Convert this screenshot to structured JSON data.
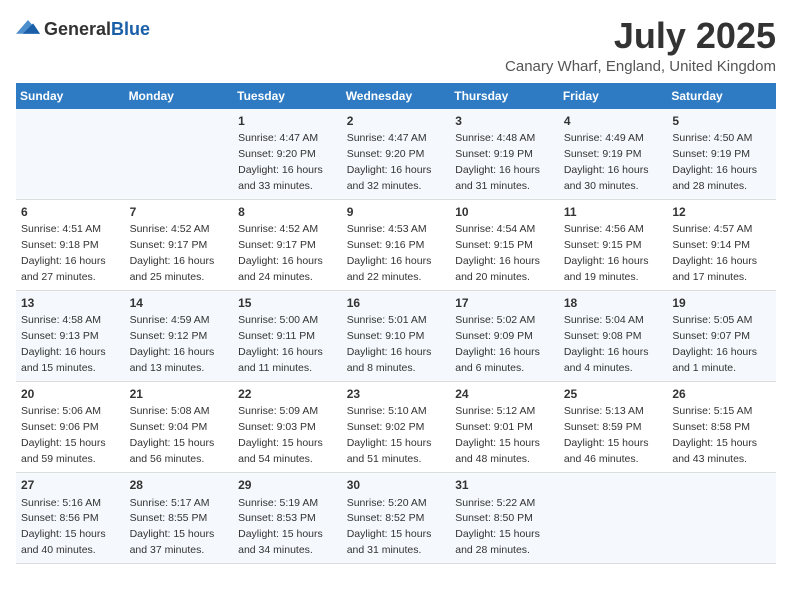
{
  "logo": {
    "general": "General",
    "blue": "Blue"
  },
  "title": "July 2025",
  "subtitle": "Canary Wharf, England, United Kingdom",
  "days_of_week": [
    "Sunday",
    "Monday",
    "Tuesday",
    "Wednesday",
    "Thursday",
    "Friday",
    "Saturday"
  ],
  "weeks": [
    [
      {
        "num": "",
        "sunrise": "",
        "sunset": "",
        "daylight": ""
      },
      {
        "num": "",
        "sunrise": "",
        "sunset": "",
        "daylight": ""
      },
      {
        "num": "1",
        "sunrise": "Sunrise: 4:47 AM",
        "sunset": "Sunset: 9:20 PM",
        "daylight": "Daylight: 16 hours and 33 minutes."
      },
      {
        "num": "2",
        "sunrise": "Sunrise: 4:47 AM",
        "sunset": "Sunset: 9:20 PM",
        "daylight": "Daylight: 16 hours and 32 minutes."
      },
      {
        "num": "3",
        "sunrise": "Sunrise: 4:48 AM",
        "sunset": "Sunset: 9:19 PM",
        "daylight": "Daylight: 16 hours and 31 minutes."
      },
      {
        "num": "4",
        "sunrise": "Sunrise: 4:49 AM",
        "sunset": "Sunset: 9:19 PM",
        "daylight": "Daylight: 16 hours and 30 minutes."
      },
      {
        "num": "5",
        "sunrise": "Sunrise: 4:50 AM",
        "sunset": "Sunset: 9:19 PM",
        "daylight": "Daylight: 16 hours and 28 minutes."
      }
    ],
    [
      {
        "num": "6",
        "sunrise": "Sunrise: 4:51 AM",
        "sunset": "Sunset: 9:18 PM",
        "daylight": "Daylight: 16 hours and 27 minutes."
      },
      {
        "num": "7",
        "sunrise": "Sunrise: 4:52 AM",
        "sunset": "Sunset: 9:17 PM",
        "daylight": "Daylight: 16 hours and 25 minutes."
      },
      {
        "num": "8",
        "sunrise": "Sunrise: 4:52 AM",
        "sunset": "Sunset: 9:17 PM",
        "daylight": "Daylight: 16 hours and 24 minutes."
      },
      {
        "num": "9",
        "sunrise": "Sunrise: 4:53 AM",
        "sunset": "Sunset: 9:16 PM",
        "daylight": "Daylight: 16 hours and 22 minutes."
      },
      {
        "num": "10",
        "sunrise": "Sunrise: 4:54 AM",
        "sunset": "Sunset: 9:15 PM",
        "daylight": "Daylight: 16 hours and 20 minutes."
      },
      {
        "num": "11",
        "sunrise": "Sunrise: 4:56 AM",
        "sunset": "Sunset: 9:15 PM",
        "daylight": "Daylight: 16 hours and 19 minutes."
      },
      {
        "num": "12",
        "sunrise": "Sunrise: 4:57 AM",
        "sunset": "Sunset: 9:14 PM",
        "daylight": "Daylight: 16 hours and 17 minutes."
      }
    ],
    [
      {
        "num": "13",
        "sunrise": "Sunrise: 4:58 AM",
        "sunset": "Sunset: 9:13 PM",
        "daylight": "Daylight: 16 hours and 15 minutes."
      },
      {
        "num": "14",
        "sunrise": "Sunrise: 4:59 AM",
        "sunset": "Sunset: 9:12 PM",
        "daylight": "Daylight: 16 hours and 13 minutes."
      },
      {
        "num": "15",
        "sunrise": "Sunrise: 5:00 AM",
        "sunset": "Sunset: 9:11 PM",
        "daylight": "Daylight: 16 hours and 11 minutes."
      },
      {
        "num": "16",
        "sunrise": "Sunrise: 5:01 AM",
        "sunset": "Sunset: 9:10 PM",
        "daylight": "Daylight: 16 hours and 8 minutes."
      },
      {
        "num": "17",
        "sunrise": "Sunrise: 5:02 AM",
        "sunset": "Sunset: 9:09 PM",
        "daylight": "Daylight: 16 hours and 6 minutes."
      },
      {
        "num": "18",
        "sunrise": "Sunrise: 5:04 AM",
        "sunset": "Sunset: 9:08 PM",
        "daylight": "Daylight: 16 hours and 4 minutes."
      },
      {
        "num": "19",
        "sunrise": "Sunrise: 5:05 AM",
        "sunset": "Sunset: 9:07 PM",
        "daylight": "Daylight: 16 hours and 1 minute."
      }
    ],
    [
      {
        "num": "20",
        "sunrise": "Sunrise: 5:06 AM",
        "sunset": "Sunset: 9:06 PM",
        "daylight": "Daylight: 15 hours and 59 minutes."
      },
      {
        "num": "21",
        "sunrise": "Sunrise: 5:08 AM",
        "sunset": "Sunset: 9:04 PM",
        "daylight": "Daylight: 15 hours and 56 minutes."
      },
      {
        "num": "22",
        "sunrise": "Sunrise: 5:09 AM",
        "sunset": "Sunset: 9:03 PM",
        "daylight": "Daylight: 15 hours and 54 minutes."
      },
      {
        "num": "23",
        "sunrise": "Sunrise: 5:10 AM",
        "sunset": "Sunset: 9:02 PM",
        "daylight": "Daylight: 15 hours and 51 minutes."
      },
      {
        "num": "24",
        "sunrise": "Sunrise: 5:12 AM",
        "sunset": "Sunset: 9:01 PM",
        "daylight": "Daylight: 15 hours and 48 minutes."
      },
      {
        "num": "25",
        "sunrise": "Sunrise: 5:13 AM",
        "sunset": "Sunset: 8:59 PM",
        "daylight": "Daylight: 15 hours and 46 minutes."
      },
      {
        "num": "26",
        "sunrise": "Sunrise: 5:15 AM",
        "sunset": "Sunset: 8:58 PM",
        "daylight": "Daylight: 15 hours and 43 minutes."
      }
    ],
    [
      {
        "num": "27",
        "sunrise": "Sunrise: 5:16 AM",
        "sunset": "Sunset: 8:56 PM",
        "daylight": "Daylight: 15 hours and 40 minutes."
      },
      {
        "num": "28",
        "sunrise": "Sunrise: 5:17 AM",
        "sunset": "Sunset: 8:55 PM",
        "daylight": "Daylight: 15 hours and 37 minutes."
      },
      {
        "num": "29",
        "sunrise": "Sunrise: 5:19 AM",
        "sunset": "Sunset: 8:53 PM",
        "daylight": "Daylight: 15 hours and 34 minutes."
      },
      {
        "num": "30",
        "sunrise": "Sunrise: 5:20 AM",
        "sunset": "Sunset: 8:52 PM",
        "daylight": "Daylight: 15 hours and 31 minutes."
      },
      {
        "num": "31",
        "sunrise": "Sunrise: 5:22 AM",
        "sunset": "Sunset: 8:50 PM",
        "daylight": "Daylight: 15 hours and 28 minutes."
      },
      {
        "num": "",
        "sunrise": "",
        "sunset": "",
        "daylight": ""
      },
      {
        "num": "",
        "sunrise": "",
        "sunset": "",
        "daylight": ""
      }
    ]
  ]
}
